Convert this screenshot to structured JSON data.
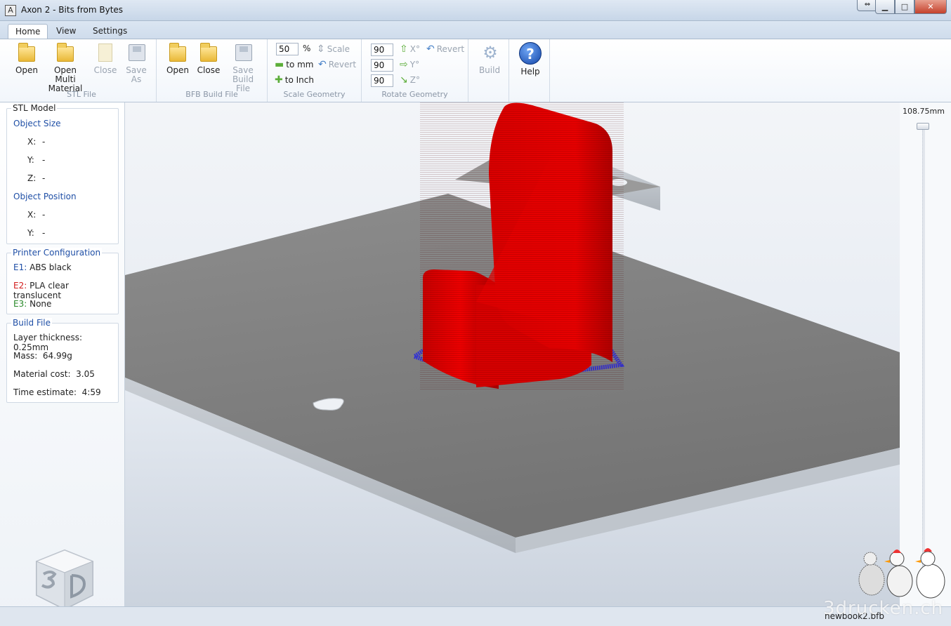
{
  "window": {
    "title": "Axon 2 - Bits from Bytes",
    "icon": "axon-app-icon",
    "controls": {
      "minimize": "▁",
      "maximize": "□",
      "close": "✕"
    }
  },
  "tabs": [
    {
      "label": "Home",
      "active": true
    },
    {
      "label": "View",
      "active": false
    },
    {
      "label": "Settings",
      "active": false
    }
  ],
  "ribbon": {
    "stl_file": {
      "label": "STL File",
      "open": "Open",
      "open_multi_line1": "Open Multi",
      "open_multi_line2": "Material",
      "close": "Close",
      "save_as_line1": "Save",
      "save_as_line2": "As"
    },
    "bfb_build_file": {
      "label": "BFB Build File",
      "open": "Open",
      "close": "Close",
      "save_line1": "Save",
      "save_line2": "Build File"
    },
    "scale_geometry": {
      "label": "Scale Geometry",
      "percent_value": "50",
      "percent_sign": "%",
      "scale": "Scale",
      "to_mm": "to mm",
      "revert": "Revert",
      "to_inch": "to Inch"
    },
    "rotate_geometry": {
      "label": "Rotate Geometry",
      "x_value": "90",
      "y_value": "90",
      "z_value": "90",
      "x_label": "X°",
      "y_label": "Y°",
      "z_label": "Z°",
      "revert": "Revert"
    },
    "build": {
      "label": "Build"
    },
    "help": {
      "label": "Help",
      "glyph": "?"
    }
  },
  "stl_model": {
    "title": "STL Model",
    "object_size": "Object Size",
    "size_x_label": "X:",
    "size_x": "-",
    "size_y_label": "Y:",
    "size_y": "-",
    "size_z_label": "Z:",
    "size_z": "-",
    "object_position": "Object Position",
    "pos_x_label": "X:",
    "pos_x": "-",
    "pos_y_label": "Y:",
    "pos_y": "-"
  },
  "printer_configuration": {
    "title": "Printer Configuration",
    "e1_label": "E1:",
    "e1_value": "ABS black",
    "e2_label": "E2:",
    "e2_value": "PLA clear translucent",
    "e3_label": "E3:",
    "e3_value": "None"
  },
  "build_file": {
    "title": "Build File",
    "layer_thickness_label": "Layer thickness:",
    "layer_thickness": "0.25mm",
    "mass_label": "Mass:",
    "mass": "64.99g",
    "material_cost_label": "Material cost:",
    "material_cost": "3.05",
    "time_estimate_label": "Time estimate:",
    "time_estimate": "4:59"
  },
  "layer_slider": {
    "value_label": "108.75mm",
    "position_fraction": 1.0
  },
  "status": {
    "filename": "newbook2.bfb"
  },
  "watermark": "3drucken.ch",
  "colors": {
    "model": "#d40000",
    "raft": "#3a3ad0",
    "plate": "#8a8a8a",
    "accent": "#1f4fa6"
  }
}
